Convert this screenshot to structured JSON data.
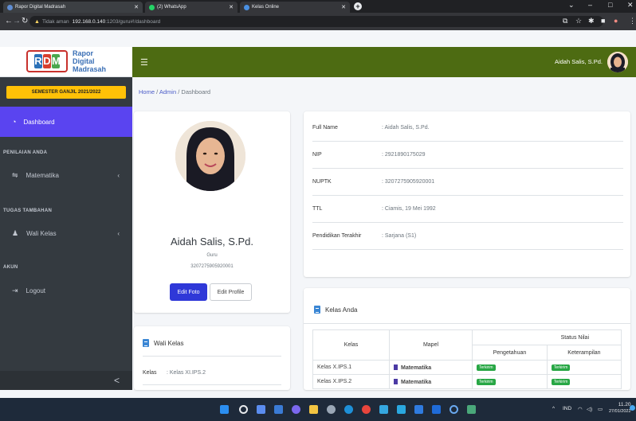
{
  "browser": {
    "tabs": [
      {
        "title": "Rapor Digital Madrasah"
      },
      {
        "title": "(2) WhatsApp"
      },
      {
        "title": "Kelas Online"
      }
    ],
    "address": {
      "security_label": "Tidak aman",
      "host": "192.168.0.140",
      "path": ":1203/guru#!/dashboard"
    }
  },
  "brand": {
    "logo_letters": [
      "R",
      "D",
      "M",
      ""
    ],
    "line1": "Rapor",
    "line2": "Digital",
    "line3": "Madrasah"
  },
  "semester": "SEMESTER GANJIL 2021/2022",
  "sidebar": {
    "active_item": "Dashboard",
    "section1": "PENILAIAN ANDA",
    "item_matematika": "Matematika",
    "section2": "TUGAS TAMBAHAN",
    "item_walikelas": "Wali Kelas",
    "section3": "AKUN",
    "item_logout": "Logout",
    "collapse": "<"
  },
  "header": {
    "user_name": "Aidah Salis, S.Pd."
  },
  "breadcrumb": {
    "home": "Home",
    "sep": "/",
    "admin": "Admin",
    "current": "Dashboard"
  },
  "profile": {
    "name": "Aidah Salis, S.Pd.",
    "role": "Guru",
    "nuptk": "3207275905920001",
    "edit_photo": "Edit Foto",
    "edit_profile": "Edit Profile"
  },
  "details": [
    {
      "label": "Full Name",
      "value": ": Aidah Salis, S.Pd."
    },
    {
      "label": "NIP",
      "value": ": 2921890175029"
    },
    {
      "label": "NUPTK",
      "value": ": 3207275905920001"
    },
    {
      "label": "TTL",
      "value": ": Ciamis, 19 Mei 1992"
    },
    {
      "label": "Pendidikan Terakhir",
      "value": ": Sarjana (S1)"
    }
  ],
  "wali_kelas": {
    "title": "Wali Kelas",
    "kelas_label": "Kelas",
    "kelas_value": ": Kelas XI.IPS.2"
  },
  "kelas_anda": {
    "title": "Kelas Anda",
    "headers": {
      "kelas": "Kelas",
      "mapel": "Mapel",
      "status": "Status Nilai",
      "pengetahuan": "Pengetahuan",
      "keterampilan": "Keterampilan"
    },
    "rows": [
      {
        "kelas": "Kelas X.IPS.1",
        "mapel": "Matematika",
        "pengetahuan": "Terkirim",
        "keterampilan": "Terkirim"
      },
      {
        "kelas": "Kelas X.IPS.2",
        "mapel": "Matematika",
        "pengetahuan": "Terkirim",
        "keterampilan": "Terkirim"
      }
    ]
  },
  "taskbar": {
    "lang": "IND",
    "time": "11.20",
    "date": "27/01/2022"
  },
  "colors": {
    "sidebar": "#343a40",
    "active": "#5a44f0",
    "topnav": "#4d6b12",
    "semester": "#ffc107",
    "primary_button": "#2f38d8",
    "badge": "#28a745"
  }
}
